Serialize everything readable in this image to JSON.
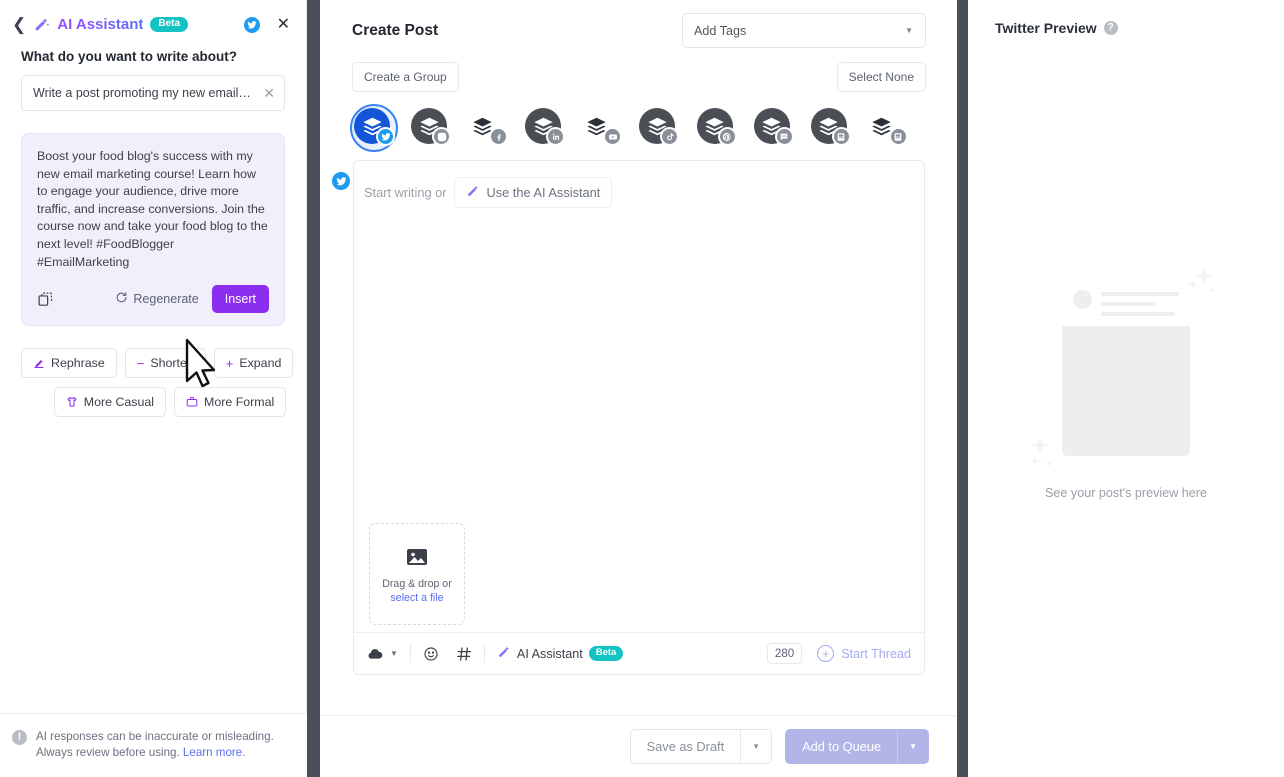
{
  "ai_panel": {
    "back_icon": "chevron-left-icon",
    "wand_icon": "magic-wand-icon",
    "title": "AI Assistant",
    "beta_badge": "Beta",
    "twitter_icon": "twitter-icon",
    "close_icon": "close-icon",
    "question": "What do you want to write about?",
    "prompt_value": "Write a post promoting my new email…",
    "prompt_clear_icon": "clear-icon",
    "result_text": "Boost your food blog's success with my new email marketing course! Learn how to engage your audience, drive more traffic, and increase conversions. Join the course now and take your food blog to the next level! #FoodBlogger #EmailMarketing",
    "copy_icon": "copy-icon",
    "regenerate_label": "Regenerate",
    "regenerate_icon": "refresh-icon",
    "insert_label": "Insert",
    "chips_row1": [
      {
        "label": "Rephrase",
        "icon": "pen-icon"
      },
      {
        "label": "Shorten",
        "icon": "minus-icon"
      },
      {
        "label": "Expand",
        "icon": "plus-icon"
      }
    ],
    "chips_row2": [
      {
        "label": "More Casual",
        "icon": "tshirt-icon"
      },
      {
        "label": "More Formal",
        "icon": "briefcase-icon"
      }
    ],
    "disclaimer": "AI responses can be inaccurate or misleading. Always review before using. ",
    "disclaimer_link": "Learn more.",
    "info_icon": "info-icon"
  },
  "create_post": {
    "title": "Create Post",
    "tags_placeholder": "Add Tags",
    "tags_caret_icon": "chevron-down-icon",
    "create_group_label": "Create a Group",
    "select_none_label": "Select None",
    "accounts": [
      {
        "platform": "twitter",
        "selected": true,
        "style": "circle"
      },
      {
        "platform": "instagram",
        "selected": false,
        "style": "circle"
      },
      {
        "platform": "facebook",
        "selected": false,
        "style": "stack"
      },
      {
        "platform": "linkedin",
        "selected": false,
        "style": "circle"
      },
      {
        "platform": "youtube",
        "selected": false,
        "style": "stack"
      },
      {
        "platform": "tiktok",
        "selected": false,
        "style": "circle"
      },
      {
        "platform": "pinterest",
        "selected": false,
        "style": "circle"
      },
      {
        "platform": "mastodon",
        "selected": false,
        "style": "circle"
      },
      {
        "platform": "generic1",
        "selected": false,
        "style": "circle"
      },
      {
        "platform": "generic2",
        "selected": false,
        "style": "stack"
      }
    ],
    "composer": {
      "avatar_icon": "twitter-icon",
      "placeholder_prefix": "Start writing or",
      "use_ai_label": "Use the AI Assistant",
      "use_ai_icon": "magic-wand-icon",
      "dropzone_icon": "image-icon",
      "dropzone_line1": "Drag & drop or",
      "dropzone_line2": "select a file",
      "toolbar": {
        "cloud_icon": "cloud-icon",
        "cloud_caret_icon": "chevron-down-icon",
        "emoji_icon": "emoji-icon",
        "hashtag_icon": "hashtag-icon",
        "ai_icon": "magic-wand-icon",
        "ai_label": "AI Assistant",
        "ai_beta": "Beta",
        "char_count": "280",
        "start_thread_label": "Start Thread",
        "start_thread_icon": "plus-circle-icon"
      }
    },
    "footer": {
      "save_draft_label": "Save as Draft",
      "save_draft_caret_icon": "chevron-down-icon",
      "add_queue_label": "Add to Queue",
      "add_queue_caret_icon": "chevron-down-icon"
    }
  },
  "preview": {
    "title": "Twitter Preview",
    "help_icon": "help-circle-icon",
    "help_glyph": "?",
    "caption": "See your post's preview here",
    "sparkle_icon": "sparkle-icon"
  },
  "cursor": {
    "icon": "mouse-pointer-icon"
  },
  "colors": {
    "accent_purple": "#8b2ef0",
    "twitter_blue": "#1d9bf0",
    "teal_badge": "#13c2c2",
    "link_blue": "#5b6ef5",
    "dim_overlay": "#4a5059",
    "primary_button": "#b1b5e8"
  }
}
